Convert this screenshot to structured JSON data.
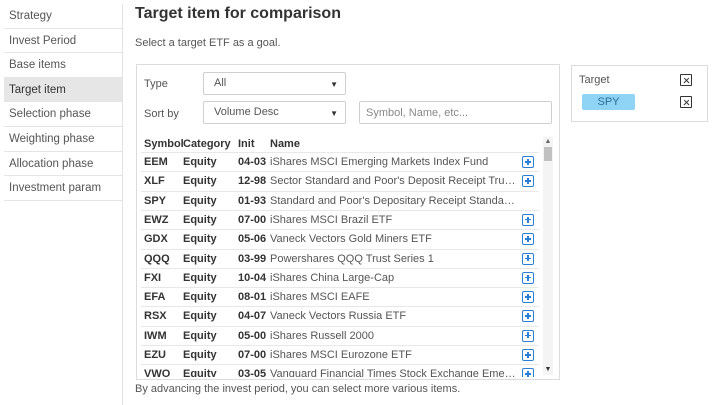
{
  "sidebar": {
    "items": [
      {
        "label": "Strategy",
        "active": false
      },
      {
        "label": "Invest Period",
        "active": false
      },
      {
        "label": "Base items",
        "active": false
      },
      {
        "label": "Target item",
        "active": true
      },
      {
        "label": "Selection phase",
        "active": false
      },
      {
        "label": "Weighting phase",
        "active": false
      },
      {
        "label": "Allocation phase",
        "active": false
      },
      {
        "label": "Investment param",
        "active": false
      }
    ]
  },
  "header": {
    "title": "Target item for comparison",
    "subtitle": "Select a target ETF as a goal."
  },
  "filters": {
    "type_label": "Type",
    "type_value": "All",
    "sort_label": "Sort by",
    "sort_value": "Volume Desc",
    "search_placeholder": "Symbol, Name, etc..."
  },
  "table": {
    "columns": [
      "Symbol",
      "Category",
      "Init",
      "Name"
    ],
    "rows": [
      {
        "symbol": "EEM",
        "category": "Equity",
        "init": "04-03",
        "name": "iShares MSCI Emerging Markets Index Fund",
        "addable": true
      },
      {
        "symbol": "XLF",
        "category": "Equity",
        "init": "12-98",
        "name": "Sector Standard and Poor's Deposit Receipt Trust I...",
        "addable": true
      },
      {
        "symbol": "SPY",
        "category": "Equity",
        "init": "01-93",
        "name": "Standard and Poor's Depositary Receipt Standard ...",
        "addable": false
      },
      {
        "symbol": "EWZ",
        "category": "Equity",
        "init": "07-00",
        "name": "iShares MSCI Brazil ETF",
        "addable": true
      },
      {
        "symbol": "GDX",
        "category": "Equity",
        "init": "05-06",
        "name": "Vaneck Vectors Gold Miners ETF",
        "addable": true
      },
      {
        "symbol": "QQQ",
        "category": "Equity",
        "init": "03-99",
        "name": "Powershares QQQ Trust Series 1",
        "addable": true
      },
      {
        "symbol": "FXI",
        "category": "Equity",
        "init": "10-04",
        "name": "iShares China Large-Cap",
        "addable": true
      },
      {
        "symbol": "EFA",
        "category": "Equity",
        "init": "08-01",
        "name": "iShares MSCI EAFE",
        "addable": true
      },
      {
        "symbol": "RSX",
        "category": "Equity",
        "init": "04-07",
        "name": "Vaneck Vectors Russia ETF",
        "addable": true
      },
      {
        "symbol": "IWM",
        "category": "Equity",
        "init": "05-00",
        "name": "iShares Russell 2000",
        "addable": true
      },
      {
        "symbol": "EZU",
        "category": "Equity",
        "init": "07-00",
        "name": "iShares MSCI Eurozone ETF",
        "addable": true
      },
      {
        "symbol": "VWO",
        "category": "Equity",
        "init": "03-05",
        "name": "Vanguard Financial Times Stock Exchange Emergi...",
        "addable": true
      }
    ]
  },
  "footnote": "By advancing the invest period, you can select more various items.",
  "target": {
    "label": "Target",
    "selected": "SPY"
  },
  "colors": {
    "accent_blue": "#2b7fd6",
    "chip_bg": "#8fd3f5",
    "active_sidebar": "#e6e6e6"
  },
  "icons": {
    "add": "plus-square-icon",
    "remove": "close-square-icon",
    "dropdown": "caret-down-icon"
  }
}
